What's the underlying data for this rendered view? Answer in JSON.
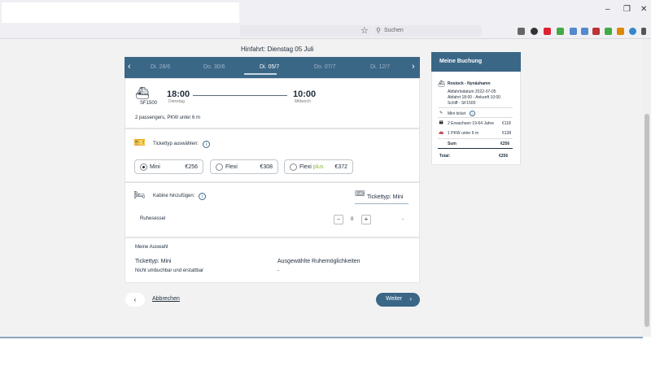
{
  "browser": {
    "search_placeholder": "Suchen",
    "minimize": "–",
    "maximize": "❐",
    "close": "✕",
    "star": "☆",
    "search_icon": "⚲"
  },
  "page": {
    "heading": "Hinfahrt: Dienstag 05 Juli",
    "dates": [
      "Di. 28/6",
      "Do. 30/6",
      "Di. 05/7",
      "Do. 07/7",
      "Di. 12/7"
    ],
    "active_date_index": 2
  },
  "trip": {
    "ship": "SF1500",
    "depart_time": "18:00",
    "depart_day": "Dienstag",
    "arrive_time": "10:00",
    "arrive_day": "Mittwoch",
    "passengers": "2 passengers, PKW unter 6 m"
  },
  "ticket": {
    "title": "Tickettyp auswählen:",
    "options": [
      {
        "label": "Mini",
        "label_plus": "",
        "price": "€256",
        "selected": true
      },
      {
        "label": "Flexi",
        "label_plus": "",
        "price": "€308",
        "selected": false
      },
      {
        "label": "Flexi",
        "label_plus": "plus",
        "price": "€372",
        "selected": false
      }
    ]
  },
  "cabin": {
    "title": "Kabine hinzufügen:",
    "ticket_type": "Tickettyp: Mini",
    "item_label": "Ruhesessel",
    "quantity": "0",
    "minus": "−",
    "plus": "+",
    "value": "-"
  },
  "selection": {
    "title": "Meine Auswahl",
    "ticket_type": "Tickettyp: Mini",
    "note": "Nicht umbuchbar und erstattbar",
    "rest_title": "Ausgewählte Ruhemöglichkeiten",
    "rest_value": "-"
  },
  "actions": {
    "back": "‹",
    "cancel": "Abbrechen",
    "next": "Weiter",
    "next_chevron": "›"
  },
  "booking": {
    "title": "Meine Buchung",
    "route": "Rostock - Nynäshamn",
    "depart_date": "Abfahrtsdatum 2022-07-05",
    "times": "Abfahrt 18:00 - Ankunft 10:00",
    "ship": "Schiff - SF1500",
    "ticket": "Mini ticket",
    "adults": "2 Erwachsen 19-64 Jahre",
    "adults_price": "€118",
    "car": "1 PKW unter 6 m",
    "car_price": "€138",
    "sum_label": "Sum",
    "sum_value": "€256",
    "total_label": "Total:",
    "total_value": "€256"
  }
}
